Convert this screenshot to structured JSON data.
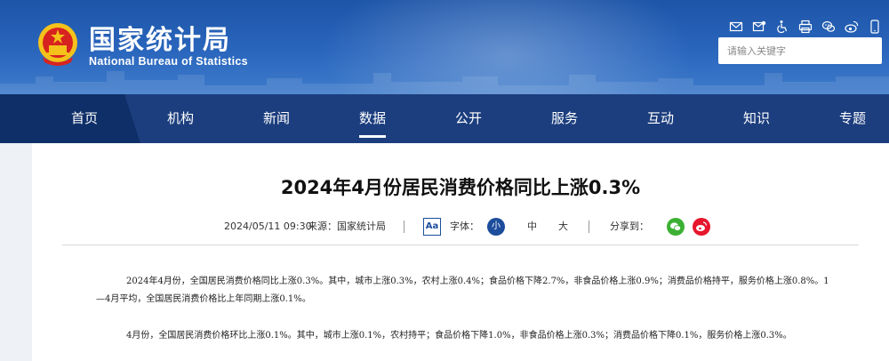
{
  "header": {
    "site_name": "国家统计局",
    "site_name_en": "National Bureau of Statistics",
    "search": {
      "placeholder": "请输入关键字"
    },
    "tools": [
      "mail-icon",
      "mailbox-icon",
      "accessibility-icon",
      "print-icon",
      "wechat-icon",
      "weibo-icon",
      "mobile-icon"
    ]
  },
  "nav": {
    "items": [
      "首页",
      "机构",
      "新闻",
      "数据",
      "公开",
      "服务",
      "互动",
      "知识",
      "专题"
    ],
    "active": "数据"
  },
  "article": {
    "title": "2024年4月份居民消费价格同比上涨0.3%",
    "date": "2024/05/11 09:30",
    "source": "来源：国家统计局",
    "aa_label": "Aa",
    "font_label": "字体：",
    "font_small": "小",
    "font_medium": "中",
    "font_large": "大",
    "share_label": "分享到：",
    "paragraphs": [
      "2024年4月份，全国居民消费价格同比上涨0.3%。其中，城市上涨0.3%，农村上涨0.4%；食品价格下降2.7%，非食品价格上涨0.9%；消费品价格持平，服务价格上涨0.8%。1—4月平均，全国居民消费价格比上年同期上涨0.1%。",
      "4月份，全国居民消费价格环比上涨0.1%。其中，城市上涨0.1%，农村持平；食品价格下降1.0%，非食品价格上涨0.3%；消费品价格下降0.1%，服务价格上涨0.3%。"
    ]
  },
  "colors": {
    "header_blue": "#2a66bd",
    "nav_blue": "#1c3e7e",
    "accent": "#1c4d9c",
    "wechat_green": "#3cb034",
    "weibo_red": "#e6162d"
  }
}
